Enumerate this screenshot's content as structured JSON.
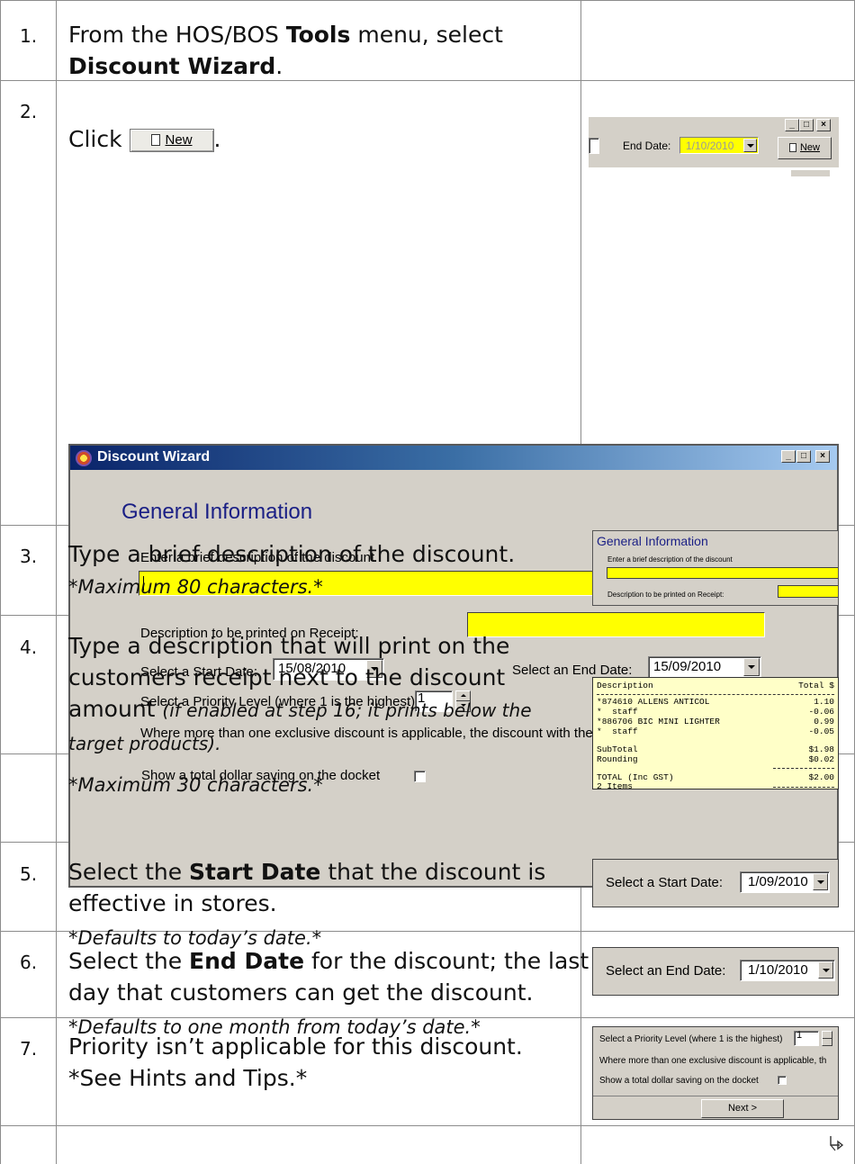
{
  "rows": [
    {
      "num": "1.",
      "parts": [
        "From the HOS/BOS ",
        "Tools",
        " menu, select",
        "Discount Wizard",
        "."
      ]
    },
    {
      "num": "2.",
      "click": "Click",
      "new_button": "New",
      "period": "."
    },
    {
      "num": "3.",
      "line1": "Type a brief description of the discount.",
      "note": "*Maximum 80 characters.*"
    },
    {
      "num": "4.",
      "line1": "Type a description that will print on the",
      "line2": "customers receipt next to the discount",
      "line3": "amount",
      "aside": "(if enabled at step 16; it prints below the",
      "aside2": "target products).",
      "note": "*Maximum 30 characters.*"
    },
    {
      "num": "5.",
      "pre": "Select the ",
      "bold": "Start Date",
      "post": " that the discount is",
      "line2": "effective in stores.",
      "note": "*Defaults to today’s date.*"
    },
    {
      "num": "6.",
      "pre": "Select the ",
      "bold": "End Date",
      "post": " for the discount; the last",
      "line2": "day that customers can get the discount.",
      "note": "*Defaults to one month from today’s date.*"
    },
    {
      "num": "7.",
      "line1": "Priority isn’t applicable for this discount.",
      "line2": "*See Hints and Tips.*"
    }
  ],
  "thumb2": {
    "end_date_label": "End Date:",
    "end_date_value": "1/10/2010",
    "new_button": "New"
  },
  "wizard": {
    "title": "Discount Wizard",
    "heading": "General Information",
    "desc_label": "Enter a brief description of the discount",
    "receipt_label": "Description to be printed on Receipt:",
    "start_label": "Select a Start Date:",
    "start_value": "15/08/2010",
    "end_label": "Select an End Date:",
    "end_value": "15/09/2010",
    "priority_label": "Select a Priority Level (where 1 is the highest)",
    "priority_value": "1",
    "priority_note": "Where more than one exclusive discount is applicable, the discount with the highest priority is applied.",
    "saving_label": "Show a total dollar saving on the docket"
  },
  "thumb3": {
    "heading": "General Information",
    "desc_label": "Enter a brief description of the discount",
    "receipt_label": "Description to be printed on Receipt:"
  },
  "receipt": {
    "header_left": "Description",
    "header_right": "Total $",
    "lines": [
      {
        "desc": "*874610 ALLENS ANTICOL",
        "amount": "1.10"
      },
      {
        "desc": "*  staff",
        "amount": "-0.06"
      },
      {
        "desc": "*886706 BIC MINI LIGHTER",
        "amount": "0.99"
      },
      {
        "desc": "*  staff",
        "amount": "-0.05"
      },
      {
        "desc": "SubTotal",
        "amount": "$1.98"
      },
      {
        "desc": "Rounding",
        "amount": "$0.02"
      },
      {
        "desc": "TOTAL (Inc GST)",
        "amount": "$2.00"
      },
      {
        "desc": "2 Items",
        "amount": ""
      }
    ]
  },
  "thumb5": {
    "label": "Select a Start Date:",
    "value": "1/09/2010"
  },
  "thumb6": {
    "label": "Select an End Date:",
    "value": "1/10/2010"
  },
  "thumb7": {
    "priority_label": "Select a Priority Level (where 1 is the highest)",
    "priority_value": "1",
    "note": "Where more than one exclusive discount is applicable, th",
    "saving_label": "Show a total dollar saving on the docket",
    "next_button": "Next >"
  },
  "continue_icon": "continue-arrow-icon"
}
